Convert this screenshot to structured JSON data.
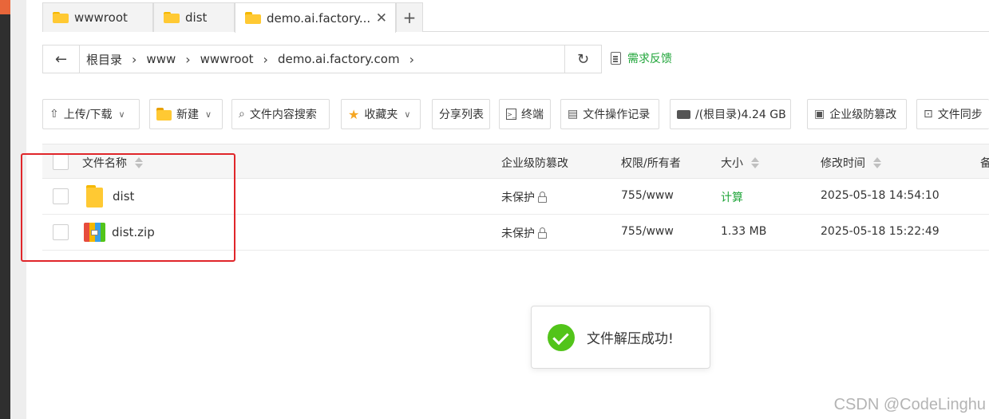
{
  "tabs": [
    {
      "label": "wwwroot"
    },
    {
      "label": "dist"
    },
    {
      "label": "demo.ai.factory..."
    }
  ],
  "tab_close_glyph": "✕",
  "tab_add_glyph": "+",
  "address": {
    "back_glyph": "←",
    "crumbs": [
      "根目录",
      "www",
      "wwwroot",
      "demo.ai.factory.com"
    ],
    "sep_glyph": "›",
    "refresh_glyph": "↻"
  },
  "feedback_label": "需求反馈",
  "toolbar": {
    "upload": "上传/下载",
    "new": "新建",
    "search_content": "文件内容搜索",
    "favorites": "收藏夹",
    "share_list": "分享列表",
    "terminal": "终端",
    "op_log": "文件操作记录",
    "disk": "/(根目录)4.24 GB",
    "tamper": "企业级防篡改",
    "sync": "文件同步"
  },
  "table": {
    "headers": {
      "name": "文件名称",
      "tamper": "企业级防篡改",
      "perm": "权限/所有者",
      "size": "大小",
      "mtime": "修改时间",
      "extra": "备"
    },
    "rows": [
      {
        "name": "dist",
        "tamper": "未保护",
        "perm": "755/www",
        "size": "计算",
        "mtime": "2025-05-18 14:54:10",
        "type": "folder"
      },
      {
        "name": "dist.zip",
        "tamper": "未保护",
        "perm": "755/www",
        "size": "1.33 MB",
        "mtime": "2025-05-18 15:22:49",
        "type": "zip"
      }
    ]
  },
  "toast": {
    "message": "文件解压成功!"
  },
  "watermark": "CSDN @CodeLinghu",
  "colors": {
    "accent_green": "#20a53a",
    "success": "#52c41a",
    "highlight_red": "#e0262a",
    "folder": "#ffc933"
  }
}
